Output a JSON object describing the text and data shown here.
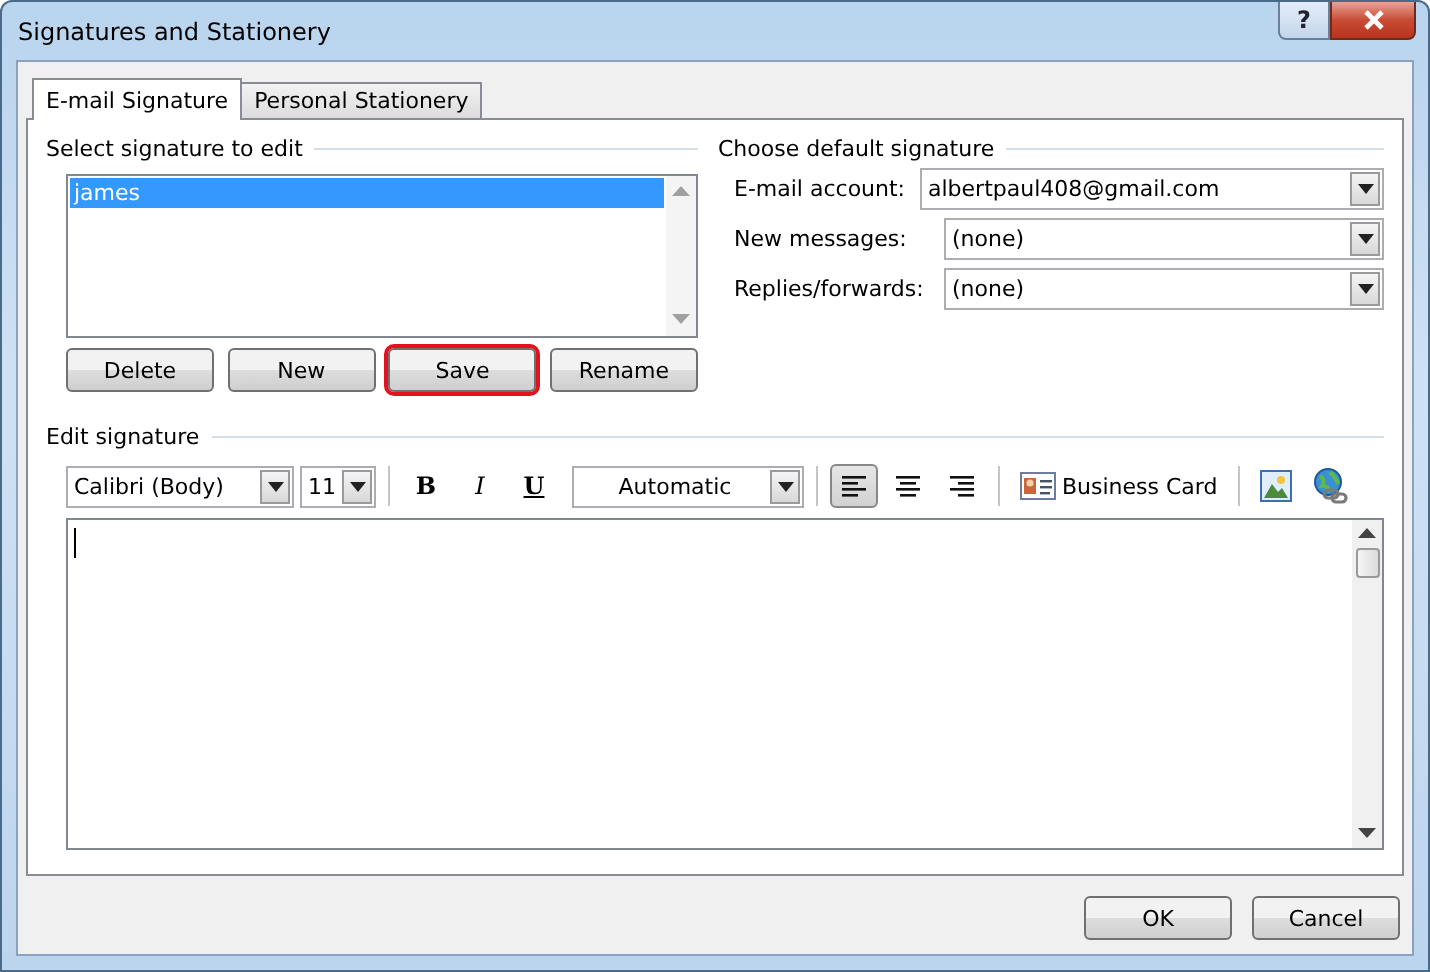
{
  "window": {
    "title": "Signatures and Stationery",
    "help": "?"
  },
  "tabs": [
    {
      "label": "E-mail Signature",
      "selected": true
    },
    {
      "label": "Personal Stationery",
      "selected": false
    }
  ],
  "select_signature": {
    "heading": "Select signature to edit",
    "items": [
      {
        "label": "james",
        "selected": true
      }
    ],
    "buttons": [
      {
        "label": "Delete",
        "highlighted": false
      },
      {
        "label": "New",
        "highlighted": false
      },
      {
        "label": "Save",
        "highlighted": true
      },
      {
        "label": "Rename",
        "highlighted": false
      }
    ]
  },
  "default_signature": {
    "heading": "Choose default signature",
    "fields": [
      {
        "label": "E-mail account:",
        "value": "albertpaul408@gmail.com"
      },
      {
        "label": "New messages:",
        "value": "(none)"
      },
      {
        "label": "Replies/forwards:",
        "value": "(none)"
      }
    ]
  },
  "edit_signature": {
    "heading": "Edit signature",
    "font": "Calibri (Body)",
    "size": "11",
    "font_color_choice": "Automatic",
    "formats": [
      {
        "kind": "bold",
        "label": "B"
      },
      {
        "kind": "italic",
        "label": "I"
      },
      {
        "kind": "underline",
        "label": "U"
      }
    ],
    "alignments": [
      {
        "kind": "left",
        "selected": true
      },
      {
        "kind": "center",
        "selected": false
      },
      {
        "kind": "right",
        "selected": false
      }
    ],
    "business_card": "Business Card"
  },
  "footer_buttons": [
    "OK",
    "Cancel"
  ]
}
